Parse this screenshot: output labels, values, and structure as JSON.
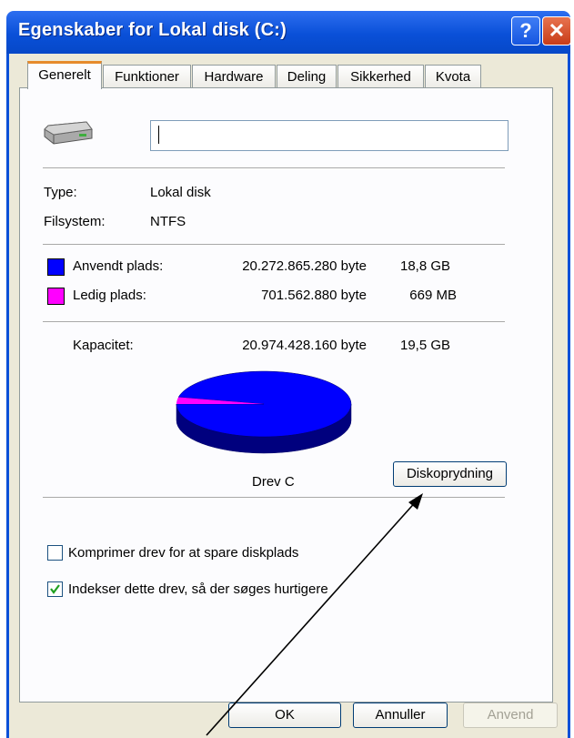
{
  "window": {
    "title": "Egenskaber for Lokal disk (C:)",
    "help_symbol": "?",
    "close_symbol": "✕"
  },
  "tabs": [
    {
      "label": "Generelt",
      "active": true
    },
    {
      "label": "Funktioner"
    },
    {
      "label": "Hardware"
    },
    {
      "label": "Deling"
    },
    {
      "label": "Sikkerhed"
    },
    {
      "label": "Kvota"
    }
  ],
  "general": {
    "name_value": "",
    "type_label": "Type:",
    "type_value": "Lokal disk",
    "fs_label": "Filsystem:",
    "fs_value": "NTFS",
    "used": {
      "label": "Anvendt plads:",
      "bytes": "20.272.865.280 byte",
      "size": "18,8 GB",
      "color": "#0000ff",
      "fraction": 0.9666
    },
    "free": {
      "label": "Ledig plads:",
      "bytes": "701.562.880 byte",
      "size": "669 MB",
      "color": "#ff00ff",
      "fraction": 0.0334
    },
    "capacity": {
      "label": "Kapacitet:",
      "bytes": "20.974.428.160 byte",
      "size": "19,5 GB"
    },
    "drive_label": "Drev C",
    "cleanup_button": "Diskoprydning",
    "compress_label": "Komprimer drev for at spare diskplads",
    "compress_checked": false,
    "index_label": "Indekser dette drev, så der søges hurtigere",
    "index_checked": true
  },
  "buttons": {
    "ok": "OK",
    "cancel": "Annuller",
    "apply": "Anvend"
  }
}
